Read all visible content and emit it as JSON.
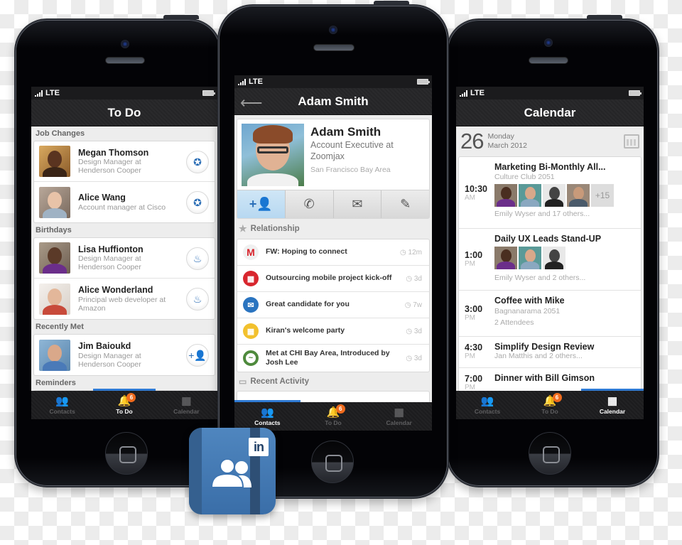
{
  "status_bar": {
    "network": "LTE"
  },
  "tabs": {
    "contacts": "Contacts",
    "todo": "To Do",
    "calendar": "Calendar",
    "todo_count": "6"
  },
  "todo_screen": {
    "title": "To Do",
    "sections": [
      {
        "heading": "Job Changes",
        "items": [
          {
            "name": "Megan Thomson",
            "line1": "Design Manager at",
            "line2": "Henderson Cooper",
            "action_icon": "award-ribbon-icon"
          },
          {
            "name": "Alice Wang",
            "line1": "Account manager at Cisco",
            "line2": "",
            "action_icon": "award-ribbon-icon"
          }
        ]
      },
      {
        "heading": "Birthdays",
        "items": [
          {
            "name": "Lisa Huffionton",
            "line1": "Design Manager at",
            "line2": "Henderson Cooper",
            "action_icon": "birthday-cake-icon"
          },
          {
            "name": "Alice Wonderland",
            "line1": "Principal web developer at",
            "line2": "Amazon",
            "action_icon": "birthday-cake-icon"
          }
        ]
      },
      {
        "heading": "Recently Met",
        "items": [
          {
            "name": "Jim Baioukd",
            "line1": "Design Manager at",
            "line2": "Henderson Cooper",
            "action_icon": "add-contact-icon"
          }
        ]
      },
      {
        "heading": "Reminders",
        "items": []
      }
    ]
  },
  "contact_screen": {
    "title": "Adam Smith",
    "profile": {
      "name": "Adam Smith",
      "title_line1": "Account Executive at",
      "title_line2": "Zoomjax",
      "location": "San Francisco Bay Area"
    },
    "actions": [
      "add-contact",
      "call",
      "email",
      "note"
    ],
    "relationship_heading": "Relationship",
    "relationship_items": [
      {
        "icon": "gmail-icon",
        "color": "#ffffff",
        "text": "FW: Hoping to connect",
        "time": "12m"
      },
      {
        "icon": "calendar-red-icon",
        "color": "#d8262e",
        "text": "Outsourcing mobile project kick-off",
        "time": "3d"
      },
      {
        "icon": "mail-blue-icon",
        "color": "#2a74c0",
        "text": "Great candidate for you",
        "time": "7w"
      },
      {
        "icon": "calendar-yellow-icon",
        "color": "#f2c12e",
        "text": "Kiran's welcome party",
        "time": "3d"
      },
      {
        "icon": "handshake-icon",
        "color": "#4e8a3c",
        "text": "Met at CHI Bay Area, Introduced by Josh Lee",
        "time": "3d"
      }
    ],
    "recent_activity_heading": "Recent Activity"
  },
  "calendar_screen": {
    "title": "Calendar",
    "date": {
      "day": "26",
      "weekday": "Monday",
      "month_year": "March 2012"
    },
    "events": [
      {
        "time": "10:30",
        "ampm": "AM",
        "title": "Marketing Bi-Monthly All...",
        "location": "Culture Club 2051",
        "attendee_photos": 4,
        "more": "+15",
        "attendees": "Emily Wyser and 17 others..."
      },
      {
        "time": "1:00",
        "ampm": "PM",
        "title": "Daily UX Leads Stand-UP",
        "location": "",
        "attendee_photos": 3,
        "more": "",
        "attendees": "Emily Wyser and 2 others..."
      },
      {
        "time": "3:00",
        "ampm": "PM",
        "title": "Coffee with Mike",
        "location": "Bagnanarama 2051",
        "attendee_photos": 0,
        "more": "",
        "attendees": "2 Attendees"
      },
      {
        "time": "4:30",
        "ampm": "PM",
        "title": "Simplify Design Review",
        "location": "",
        "attendee_photos": 0,
        "more": "",
        "attendees": "Jan Matthis and 2 others..."
      },
      {
        "time": "7:00",
        "ampm": "PM",
        "title": "Dinner with Bill Gimson",
        "location": "",
        "attendee_photos": 0,
        "more": "",
        "attendees": ""
      }
    ]
  },
  "app_icon": {
    "badge": "in"
  },
  "colors": {
    "accent": "#2f7ad3",
    "badge": "#f06b1d",
    "linkedin_blue": "#3a6ea8"
  }
}
